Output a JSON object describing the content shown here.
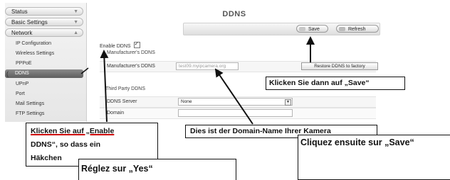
{
  "sidebar": {
    "status": "Status",
    "basic_settings": "Basic Settings",
    "network": "Network",
    "items": [
      "IP Configuration",
      "Wireless Settings",
      "PPPoE",
      "DDNS",
      "UPnP",
      "Port",
      "Mail Settings",
      "FTP Settings"
    ]
  },
  "page": {
    "title": "DDNS",
    "save": "Save",
    "refresh": "Refresh"
  },
  "form": {
    "enable_ddns_label": "Enable DDNS",
    "manufacturer_section": "Manufacturer's DDNS",
    "manufacturer_label": "Manufacturer's DDNS",
    "manufacturer_value": "test09.myipcamera.org",
    "restore_button": "Restore DDNS to factory",
    "third_party_section": "Third Party DDNS",
    "ddns_server_label": "DDNS Server",
    "ddns_server_value": "None",
    "domain_label": "Domain"
  },
  "annotations": {
    "save_de": "Klicken Sie dann auf „Save“",
    "enable_de_1": "Klicken Sie auf „Enable",
    "enable_de_2": "DDNS“, so dass ein",
    "enable_de_3": "Häkchen",
    "domain_de": "Dies ist der Domain-Name Ihrer Kamera",
    "save_fr": "Cliquez ensuite sur „Save“",
    "yes_fr": "Réglez sur „Yes“"
  }
}
